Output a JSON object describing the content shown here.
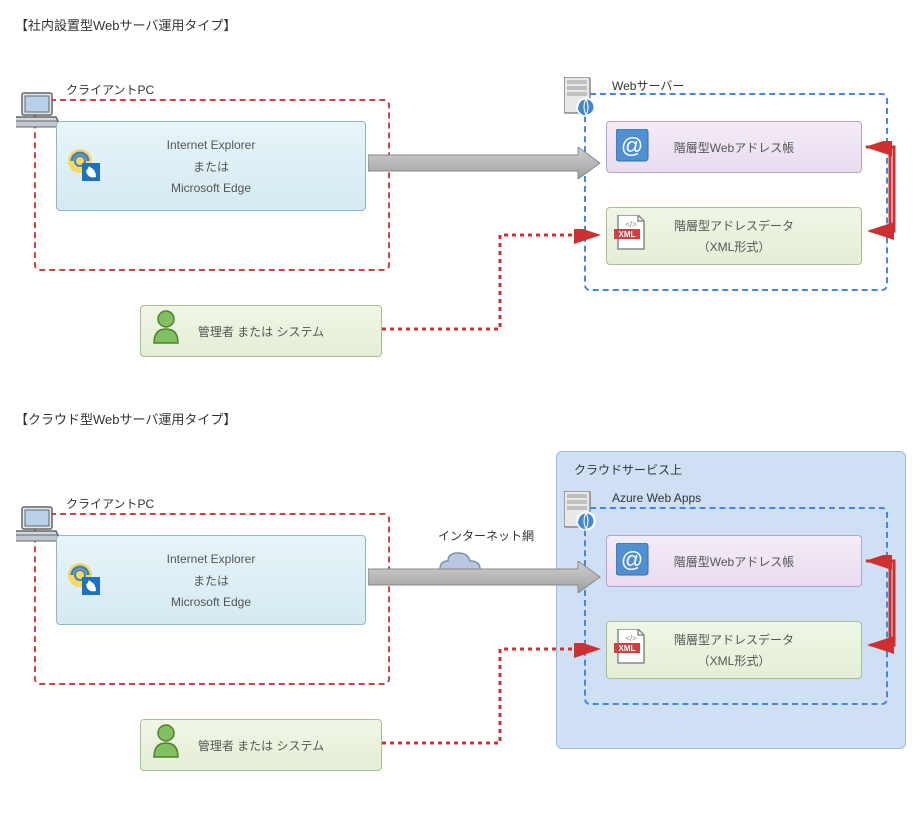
{
  "section1": {
    "title": "【社内設置型Webサーバ運用タイプ】",
    "clientLabel": "クライアントPC",
    "webServerLabel": "Webサーバー",
    "browser": {
      "line1": "Internet Explorer",
      "line2": "または",
      "line3": "Microsoft Edge"
    },
    "admin": "管理者 または システム",
    "webAddress": "階層型Webアドレス帳",
    "xml": {
      "line1": "階層型アドレスデータ",
      "line2": "（XML形式）"
    }
  },
  "section2": {
    "title": "【クラウド型Webサーバ運用タイプ】",
    "cloudLabel": "クラウドサービス上",
    "clientLabel": "クライアントPC",
    "azureLabel": "Azure Web Apps",
    "internetLabel": "インターネット網",
    "browser": {
      "line1": "Internet Explorer",
      "line2": "または",
      "line3": "Microsoft Edge"
    },
    "admin": "管理者 または システム",
    "webAddress": "階層型Webアドレス帳",
    "xml": {
      "line1": "階層型アドレスデータ",
      "line2": "（XML形式）"
    }
  }
}
